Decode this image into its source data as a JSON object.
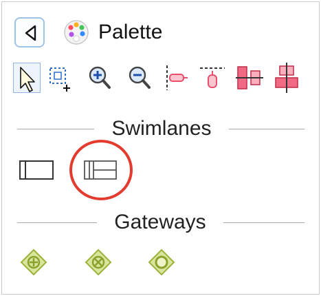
{
  "palette": {
    "title": "Palette",
    "sections": [
      {
        "label": "Swimlanes",
        "items": [
          "pool-tool",
          "lane-tool"
        ]
      },
      {
        "label": "Gateways",
        "items": [
          "exclusive-gateway-tool",
          "complex-gateway-tool",
          "inclusive-gateway-tool"
        ]
      }
    ]
  },
  "colors": {
    "highlight": "#e33b2e",
    "gateway_fill": "#d8e59a",
    "gateway_stroke": "#9bb23a",
    "align_pink": "#e94f6d"
  },
  "icons": {
    "collapse": "triangle-left-icon",
    "palette": "paint-palette-icon",
    "tools": [
      "pointer-icon",
      "marquee-select-icon",
      "zoom-in-icon",
      "zoom-out-icon",
      "align-left-icon",
      "align-top-icon",
      "align-middle-icon",
      "align-center-icon"
    ]
  }
}
